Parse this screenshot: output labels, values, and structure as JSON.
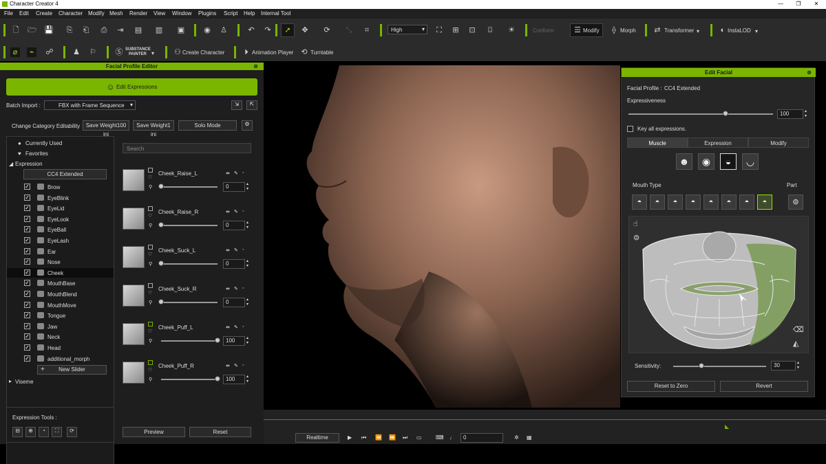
{
  "window": {
    "title": "Character Creator 4"
  },
  "menu": [
    "File",
    "Edit",
    "Create",
    "Character",
    "Modify",
    "Mesh",
    "Render",
    "View",
    "Window",
    "Plugins",
    "Script",
    "Help",
    "Internal Tool"
  ],
  "toolbar": {
    "quality": "High",
    "conform": "Conform",
    "modify": "Modify",
    "morph": "Morph",
    "transformer": "Transformer",
    "instalod": "InstaLOD",
    "create_character": "Create Character",
    "animation_player": "Animation Player",
    "turntable": "Turntable",
    "substance_line1": "SUBSTANCE",
    "substance_line2": "PAINTER"
  },
  "left_panel": {
    "title": "Facial Profile Editor",
    "edit_expressions": "Edit Expressions",
    "batch_import_label": "Batch Import :",
    "batch_import_value": "FBX with Frame Sequence",
    "change_category": "Change Category Editability",
    "save_weight_100": "Save Weight100 ini",
    "save_weight_1": "Save Weight1 ini",
    "solo_mode": "Solo Mode",
    "currently_used": "Currently Used",
    "favorites": "Favorites",
    "expression": "Expression",
    "cc4_extended": "CC4 Extended",
    "categories": [
      "Brow",
      "EyeBlink",
      "EyeLid",
      "EyeLook",
      "EyeBall",
      "EyeLash",
      "Ear",
      "Nose",
      "Cheek",
      "MouthBase",
      "MouthBlend",
      "MouthMove",
      "Tongue",
      "Jaw",
      "Neck",
      "Head",
      "additional_morph"
    ],
    "new_slider": "New Slider",
    "viseme": "Viseme",
    "expression_tools": "Expression Tools :",
    "search_placeholder": "Search",
    "sliders": [
      {
        "name": "Cheek_Raise_L",
        "value": "0",
        "level": 0
      },
      {
        "name": "Cheek_Raise_R",
        "value": "0",
        "level": 0
      },
      {
        "name": "Cheek_Suck_L",
        "value": "0",
        "level": 0
      },
      {
        "name": "Cheek_Suck_R",
        "value": "0",
        "level": 0
      },
      {
        "name": "Cheek_Puff_L",
        "value": "100",
        "level": 1
      },
      {
        "name": "Cheek_Puff_R",
        "value": "100",
        "level": 1
      }
    ],
    "preview": "Preview",
    "reset": "Reset"
  },
  "edit_facial": {
    "title": "Edit Facial",
    "facial_profile_label": "Facial Profile :",
    "facial_profile_value": "CC4 Extended",
    "expressiveness": "Expressiveness",
    "expressiveness_value": "100",
    "expressiveness_level": 0.67,
    "key_all": "Key all expressions.",
    "tabs": [
      "Muscle",
      "Expression",
      "Modify"
    ],
    "mouth_type": "Mouth Type",
    "part": "Part",
    "sensitivity": "Sensitivity:",
    "sensitivity_value": "30",
    "sensitivity_level": 0.3,
    "reset_to_zero": "Reset to Zero",
    "revert": "Revert"
  },
  "timeline": {
    "realtime": "Realtime",
    "frame": "0"
  },
  "colors": {
    "accent": "#7ab500",
    "panel": "#1e1e1e",
    "toolbar": "#2b2b2b"
  }
}
